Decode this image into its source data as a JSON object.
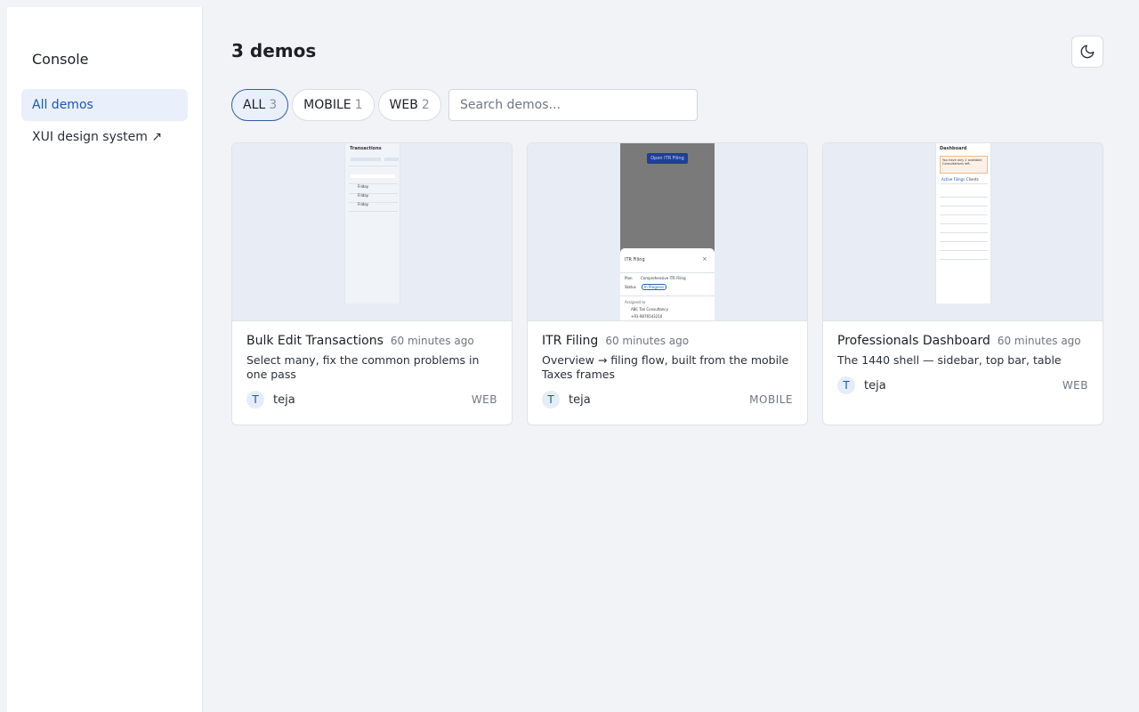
{
  "sidebar": {
    "brand": "Console",
    "items": [
      {
        "label": "All demos"
      },
      {
        "label": "XUI design system ↗"
      }
    ]
  },
  "header": {
    "title": "3 demos",
    "theme_icon": "moon-icon"
  },
  "filters": [
    {
      "label": "ALL",
      "count": "3"
    },
    {
      "label": "MOBILE",
      "count": "1"
    },
    {
      "label": "WEB",
      "count": "2"
    }
  ],
  "search": {
    "placeholder": "Search demos..."
  },
  "cards": [
    {
      "title": "Bulk Edit Transactions",
      "time": "60 minutes ago",
      "description": "Select many, fix the common problems in one pass",
      "author_initial": "T",
      "author": "teja",
      "platform": "WEB",
      "preview": {
        "heading": "Transactions",
        "rows": [
          "Friday",
          "Friday",
          "Friday"
        ]
      }
    },
    {
      "title": "ITR Filing",
      "time": "60 minutes ago",
      "description": "Overview → filing flow, built from the mobile Taxes frames",
      "author_initial": "T",
      "author": "teja",
      "platform": "MOBILE",
      "preview": {
        "button": "Open ITR Filing",
        "sheet_title": "ITR Filing",
        "plan_label": "Plan",
        "plan_value": "Comprehensive ITR Filing",
        "status_label": "Status",
        "status_value": "In Progress",
        "assigned_label": "Assigned to",
        "assigned_value": "ABC Tax Consultancy",
        "phone": "+91-9876543210"
      }
    },
    {
      "title": "Professionals Dashboard",
      "time": "60 minutes ago",
      "description": "The 1440 shell — sidebar, top bar, table",
      "author_initial": "T",
      "author": "teja",
      "platform": "WEB",
      "preview": {
        "heading": "Dashboard",
        "alert": "You have only 2 available Consultations left.",
        "tab1": "Active Filings",
        "tab2": "Clients"
      }
    }
  ],
  "colors": {
    "accent": "#1a56b8",
    "active_bg": "#e9f0fb",
    "page_bg": "#f2f3f6"
  }
}
